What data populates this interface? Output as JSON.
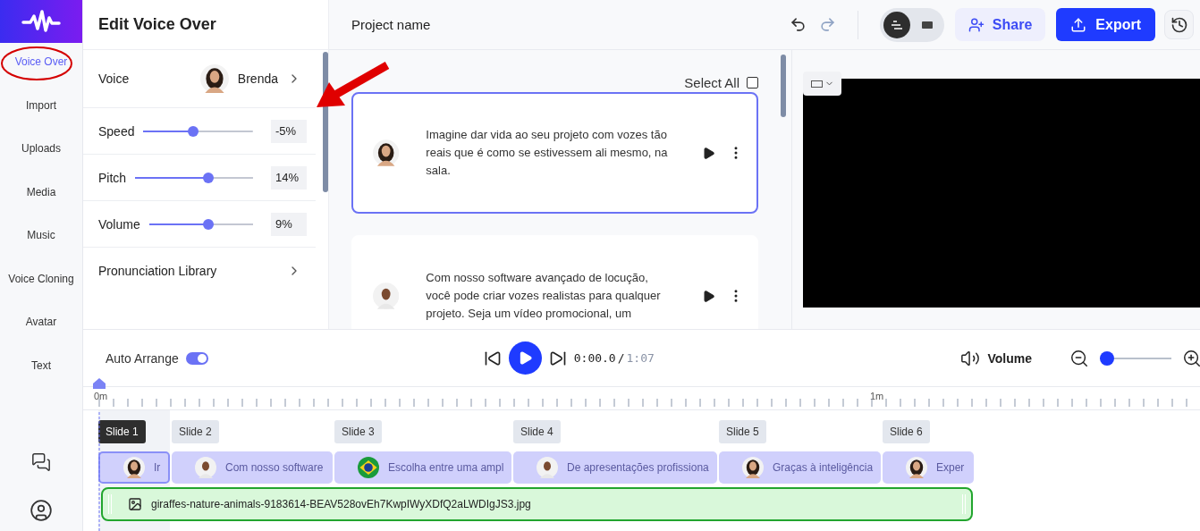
{
  "sidebar": {
    "items": [
      {
        "label": "Voice Over",
        "selected": true
      },
      {
        "label": "Import",
        "selected": false
      },
      {
        "label": "Uploads",
        "selected": false
      },
      {
        "label": "Media",
        "selected": false
      },
      {
        "label": "Music",
        "selected": false
      },
      {
        "label": "Voice Cloning",
        "selected": false
      },
      {
        "label": "Avatar",
        "selected": false
      },
      {
        "label": "Text",
        "selected": false
      }
    ]
  },
  "editor": {
    "title": "Edit Voice Over",
    "voice": {
      "label": "Voice",
      "name": "Brenda",
      "kind": "woman"
    },
    "sliders": [
      {
        "label": "Speed",
        "level": 0.45,
        "value": "-5%"
      },
      {
        "label": "Pitch",
        "level": 0.63,
        "value": "14%"
      },
      {
        "label": "Volume",
        "level": 0.58,
        "value": "9%"
      }
    ],
    "pronunciation": "Pronunciation Library"
  },
  "header": {
    "project_name": "Project name",
    "view_modes": [
      {
        "selected": true
      },
      {
        "selected": false
      }
    ],
    "share": "Share",
    "export": "Export"
  },
  "scripts": {
    "select_all": {
      "label": "Select All",
      "checked": false
    },
    "items": [
      {
        "kind": "woman",
        "selected": true,
        "text": "Imagine dar vida ao seu projeto com vozes tão reais que é como se estivessem ali mesmo, na sala."
      },
      {
        "kind": "man",
        "selected": false,
        "text": "Com nosso software avançado de locução, você pode criar vozes realistas para qualquer projeto. Seja um vídeo promocional, um"
      }
    ]
  },
  "playback": {
    "auto_arrange": {
      "label": "Auto Arrange",
      "on": true
    },
    "current_time": "0:00.0",
    "separator": "/",
    "total_time": "1:07",
    "volume_label": "Volume",
    "zoom": {
      "level": 0
    }
  },
  "timeline": {
    "ruler_labels": [
      "0m",
      "1m"
    ],
    "slides": [
      {
        "label": "Slide 1",
        "selected": true,
        "clip": {
          "kind": "woman",
          "text": "Ir"
        }
      },
      {
        "label": "Slide 2",
        "selected": false,
        "clip": {
          "kind": "man",
          "text": "Com nosso software"
        }
      },
      {
        "label": "Slide 3",
        "selected": false,
        "clip": {
          "kind": "flag",
          "text": "Escolha entre uma ampl"
        }
      },
      {
        "label": "Slide 4",
        "selected": false,
        "clip": {
          "kind": "man",
          "text": "De apresentações profissiona"
        }
      },
      {
        "label": "Slide 5",
        "selected": false,
        "clip": {
          "kind": "woman",
          "text": "Graças à inteligência"
        }
      },
      {
        "label": "Slide 6",
        "selected": false,
        "clip": {
          "kind": "woman",
          "text": "Exper"
        }
      }
    ],
    "media": {
      "file": "giraffes-nature-animals-9183614-BEAV528ovEh7KwpIWyXDfQ2aLWDIgJS3.jpg"
    }
  }
}
